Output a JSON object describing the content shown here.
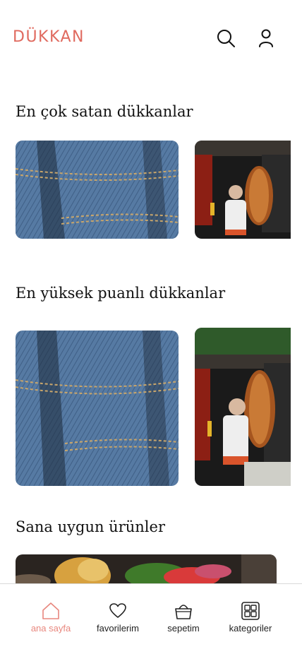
{
  "header": {
    "logo": "DÜKKAN",
    "icons": [
      "search-icon",
      "user-icon"
    ]
  },
  "sections": {
    "best_sellers": {
      "title": "En çok satan dükkanlar"
    },
    "top_rated": {
      "title": "En yüksek puanlı dükkanlar"
    },
    "for_you": {
      "title": "Sana uygun ürünler"
    }
  },
  "bottom_nav": {
    "items": [
      {
        "label": "ana sayfa",
        "icon": "home-icon",
        "active": true
      },
      {
        "label": "favorilerim",
        "icon": "heart-icon",
        "active": false
      },
      {
        "label": "sepetim",
        "icon": "basket-icon",
        "active": false
      },
      {
        "label": "kategoriler",
        "icon": "grid-icon",
        "active": false
      }
    ]
  },
  "colors": {
    "accent": "#e06a5f",
    "active_nav": "#e8877e",
    "divider": "#d9d9d9"
  }
}
